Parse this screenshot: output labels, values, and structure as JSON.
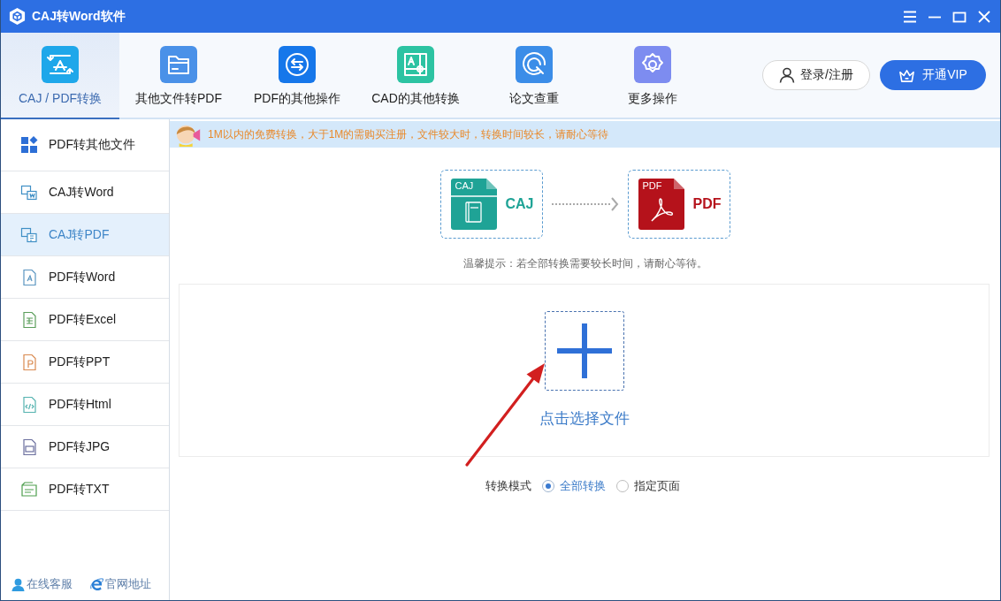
{
  "window": {
    "title": "CAJ转Word软件"
  },
  "toolbar": {
    "tabs": [
      {
        "label": "CAJ / PDF转换",
        "selected": true
      },
      {
        "label": "其他文件转PDF",
        "selected": false
      },
      {
        "label": "PDF的其他操作",
        "selected": false
      },
      {
        "label": "CAD的其他转换",
        "selected": false
      },
      {
        "label": "论文查重",
        "selected": false
      },
      {
        "label": "更多操作",
        "selected": false
      }
    ],
    "login": "登录/注册",
    "vip": "开通VIP"
  },
  "sidebar": {
    "items": [
      {
        "label": "PDF转其他文件",
        "kind": "group",
        "selected": false
      },
      {
        "label": "CAJ转Word",
        "kind": "file",
        "selected": false
      },
      {
        "label": "CAJ转PDF",
        "kind": "file",
        "selected": true
      },
      {
        "label": "PDF转Word",
        "kind": "file",
        "selected": false
      },
      {
        "label": "PDF转Excel",
        "kind": "file",
        "selected": false
      },
      {
        "label": "PDF转PPT",
        "kind": "file",
        "selected": false
      },
      {
        "label": "PDF转Html",
        "kind": "file",
        "selected": false
      },
      {
        "label": "PDF转JPG",
        "kind": "file",
        "selected": false
      },
      {
        "label": "PDF转TXT",
        "kind": "file",
        "selected": false
      }
    ],
    "footer_links": [
      "在线客服",
      "官网地址"
    ]
  },
  "notice": "1M以内的免费转换，大于1M的需购买注册，文件较大时，转换时间较长，请耐心等待",
  "conversion": {
    "source": {
      "badge": "CAJ",
      "label": "CAJ",
      "color": "#1fa396"
    },
    "target": {
      "badge": "PDF",
      "label": "PDF",
      "color": "#b5121b"
    }
  },
  "hint": "温馨提示：若全部转换需要较长时间，请耐心等待。",
  "upload": {
    "label": "点击选择文件"
  },
  "mode": {
    "label": "转换模式",
    "options": [
      {
        "label": "全部转换",
        "selected": true
      },
      {
        "label": "指定页面",
        "selected": false
      }
    ]
  }
}
